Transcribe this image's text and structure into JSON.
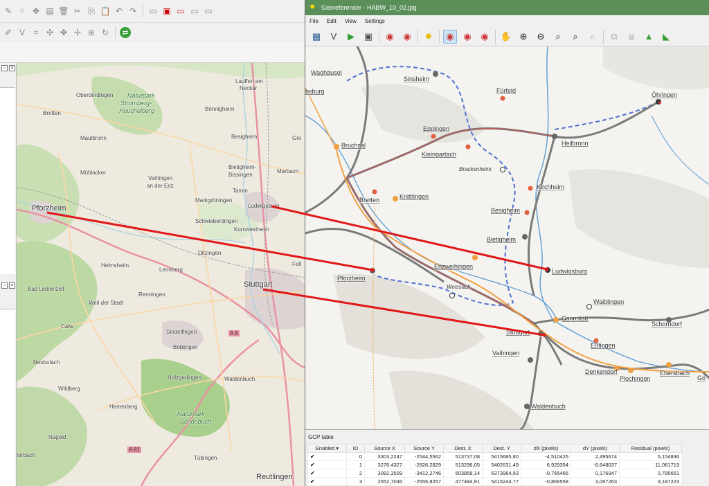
{
  "qgis": {
    "toolbar_icons": [
      "digitize-icon",
      "node-icon",
      "move-icon",
      "table-icon",
      "delete-icon",
      "cut-icon",
      "copy-icon",
      "paste-icon",
      "undo-icon",
      "redo-icon",
      "label-icon",
      "label-pin-icon",
      "label-red-icon"
    ],
    "share_icon": "share-icon"
  },
  "georeferencer": {
    "title": "Georeferencer - HABW_10_02.jpg",
    "menu": [
      "File",
      "Edit",
      "View",
      "Settings"
    ]
  },
  "osm_labels": [
    {
      "text": "Lauffen am"
    },
    {
      "text": "Neckar"
    },
    {
      "text": "Oberderdingen"
    },
    {
      "text": "Naturpark"
    },
    {
      "text": "Stromberg-"
    },
    {
      "text": "Heuchelberg"
    },
    {
      "text": "Bönnigheim"
    },
    {
      "text": "Bretten"
    },
    {
      "text": "Maulbronn"
    },
    {
      "text": "Besigheim"
    },
    {
      "text": "Mühlacker"
    },
    {
      "text": "Vaihingen"
    },
    {
      "text": "an der Enz"
    },
    {
      "text": "Bietigheim-"
    },
    {
      "text": "Bissingen"
    },
    {
      "text": "Tamm"
    },
    {
      "text": "Marbach"
    },
    {
      "text": "Markgröningen"
    },
    {
      "text": "Pforzheim"
    },
    {
      "text": "Ludwigsburg"
    },
    {
      "text": "Schwieberdingen"
    },
    {
      "text": "Kornwestheim"
    },
    {
      "text": "Ditzingen"
    },
    {
      "text": "Heimsheim"
    },
    {
      "text": "Leonberg"
    },
    {
      "text": "Bad Liebenzell"
    },
    {
      "text": "Stuttgart"
    },
    {
      "text": "Renningen"
    },
    {
      "text": "Weil der Stadt"
    },
    {
      "text": "Calw"
    },
    {
      "text": "Sindelfingen"
    },
    {
      "text": "Böblingen"
    },
    {
      "text": "Neubulach"
    },
    {
      "text": "Holzgerlingen"
    },
    {
      "text": "Waldenbuch"
    },
    {
      "text": "Wildberg"
    },
    {
      "text": "Herrenberg"
    },
    {
      "text": "Naturpark"
    },
    {
      "text": "Schönbuch"
    },
    {
      "text": "Nagold"
    },
    {
      "text": "Tübingen"
    },
    {
      "text": "Reutlingen"
    },
    {
      "text": "A 8"
    },
    {
      "text": "A 81"
    },
    {
      "text": "terbach"
    },
    {
      "text": "Gro"
    },
    {
      "text": "Fell"
    }
  ],
  "hist_labels": [
    {
      "text": "Waghäusel"
    },
    {
      "text": "Sinsheim"
    },
    {
      "text": "bsburg"
    },
    {
      "text": "Fürfeld"
    },
    {
      "text": "Öhringen"
    },
    {
      "text": "Eppingen"
    },
    {
      "text": "Bruchsal"
    },
    {
      "text": "Heilbronn"
    },
    {
      "text": "Kleingartach"
    },
    {
      "text": "Brackenheim"
    },
    {
      "text": "Kirchheim"
    },
    {
      "text": "Bretten"
    },
    {
      "text": "Knittlingen"
    },
    {
      "text": "Besigheim"
    },
    {
      "text": "Bietigheim"
    },
    {
      "text": "Pforzheim"
    },
    {
      "text": "Enzweihingen"
    },
    {
      "text": "Ludwigsburg"
    },
    {
      "text": "Weissach"
    },
    {
      "text": "Waiblingen"
    },
    {
      "text": "Cannstatt"
    },
    {
      "text": "Schorndorf"
    },
    {
      "text": "Stuttgart"
    },
    {
      "text": "Eßlingen"
    },
    {
      "text": "Vaihingen"
    },
    {
      "text": "Denkendorf"
    },
    {
      "text": "Plochingen"
    },
    {
      "text": "Ebersbach"
    },
    {
      "text": "Waldenbuch"
    },
    {
      "text": "Gö"
    }
  ],
  "gcp": {
    "title": "GCP table",
    "headers": [
      "Enabled",
      "ID",
      "Source X",
      "Source Y",
      "Dest. X",
      "Dest. Y",
      "dX (pixels)",
      "dY (pixels)",
      "Residual (pixels)"
    ],
    "rows": [
      {
        "enabled": "✔",
        "id": "0",
        "source_x": "3303,2247",
        "source_y": "-2544,5562",
        "dest_x": "513737,08",
        "dest_y": "5415685,80",
        "dx": "-4,510426",
        "dy": "2,495674",
        "residual": "5,154836"
      },
      {
        "enabled": "✔",
        "id": "1",
        "source_x": "3278,4327",
        "source_y": "-2826,2829",
        "dest_x": "513296,05",
        "dest_y": "5402631,49",
        "dx": "6,929354",
        "dy": "-8,648037",
        "residual": "11,081719"
      },
      {
        "enabled": "✔",
        "id": "2",
        "source_x": "3082,3509",
        "source_y": "-3412,2746",
        "dest_x": "503858,14",
        "dest_y": "5373964,93",
        "dx": "-0,765466",
        "dy": "0,176947",
        "residual": "0,785651"
      },
      {
        "enabled": "✔",
        "id": "3",
        "source_x": "2552,7046",
        "source_y": "-2555,8257",
        "dest_x": "477484,91",
        "dest_y": "5415244,77",
        "dx": "-0,866558",
        "dy": "3,067263",
        "residual": "3,187223"
      }
    ]
  }
}
